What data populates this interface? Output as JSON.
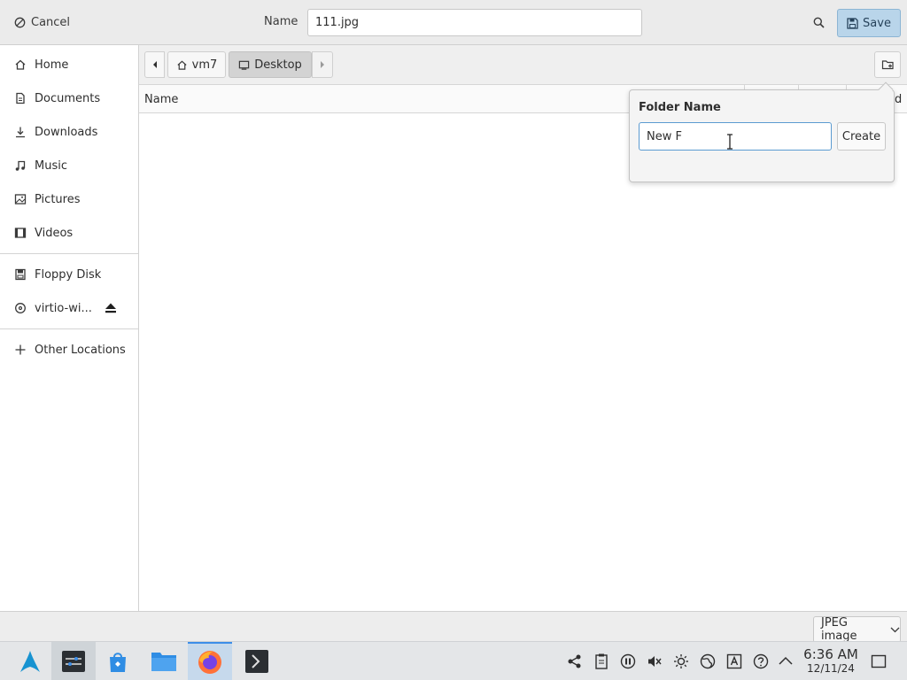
{
  "header": {
    "cancel_label": "Cancel",
    "name_label": "Name",
    "filename_value": "111.jpg",
    "save_label": "Save"
  },
  "sidebar": {
    "items": [
      {
        "label": "Home",
        "icon": "home-icon"
      },
      {
        "label": "Documents",
        "icon": "document-icon"
      },
      {
        "label": "Downloads",
        "icon": "download-icon"
      },
      {
        "label": "Music",
        "icon": "music-icon"
      },
      {
        "label": "Pictures",
        "icon": "picture-icon"
      },
      {
        "label": "Videos",
        "icon": "video-icon"
      },
      {
        "label": "Floppy Disk",
        "icon": "floppy-icon"
      },
      {
        "label": "virtio-wi...",
        "icon": "disc-icon"
      },
      {
        "label": "Other Locations",
        "icon": "plus-icon"
      }
    ]
  },
  "pathbar": {
    "segments": [
      "vm7",
      "Desktop"
    ],
    "active_segment": "Desktop"
  },
  "filelist": {
    "columns": [
      "Name"
    ],
    "partial_column_text": "d"
  },
  "popover": {
    "title": "Folder Name",
    "input_value": "New F",
    "create_label": "Create"
  },
  "filter": {
    "selected": "JPEG image"
  },
  "taskbar": {
    "time": "6:36 AM",
    "date": "12/11/24"
  },
  "colors": {
    "accent": "#3d8ee8",
    "save_button_bg": "#b9d5ea",
    "input_focus_border": "#5b9bd1"
  }
}
